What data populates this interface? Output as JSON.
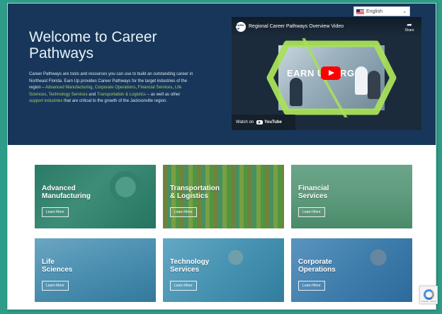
{
  "language": {
    "selected": "English"
  },
  "hero": {
    "title": "Welcome to Career Pathways",
    "p1": "Career Pathways are tools and resources you can use to build an outstanding career in Northeast Florida. Earn Up provides Career Pathways for the target industries of the region – ",
    "link_advanced": "Advanced Manufacturing",
    "sep1": ", ",
    "link_corporate": "Corporate Operations",
    "sep2": ", ",
    "link_financial": "Financial Services",
    "sep3": ", ",
    "link_life": "Life Sciences",
    "sep4": ", ",
    "link_tech": "Technology Services",
    "and": " and ",
    "link_transport": "Transportation & Logistics",
    "p2": " – as well as other ",
    "link_support": "support industries",
    "p3": " that are critical to the growth of the Jacksonville region."
  },
  "video": {
    "channel_badge": "EARN UP",
    "title": "Regional Career Pathways Overview Video",
    "share_label": "Share",
    "watch_on": "Watch on",
    "youtube": "YouTube",
    "thumbnail_text": "EARN UP.ORG"
  },
  "cards": [
    {
      "line1": "Advanced",
      "line2": "Manufacturing",
      "button": "Learn More",
      "tint": "#1e8d70"
    },
    {
      "line1": "Transportation",
      "line2": "& Logistics",
      "button": "Learn More",
      "tint": "#4b9c3e"
    },
    {
      "line1": "Financial",
      "line2": "Services",
      "button": "Learn More",
      "tint": "#3c8a63"
    },
    {
      "line1": "Life",
      "line2": "Sciences",
      "button": "Learn More",
      "tint": "#2a7fa8"
    },
    {
      "line1": "Technology",
      "line2": "Services",
      "button": "Learn More",
      "tint": "#2f8fb4"
    },
    {
      "line1": "Corporate",
      "line2": "Operations",
      "button": "Learn More",
      "tint": "#2b78b0"
    }
  ],
  "recaptcha": {
    "text": "Privacy - Terms"
  },
  "colors": {
    "hero_bg": "#17365a",
    "accent_green": "#a8d06a",
    "page_bg": "#2d9c89"
  }
}
